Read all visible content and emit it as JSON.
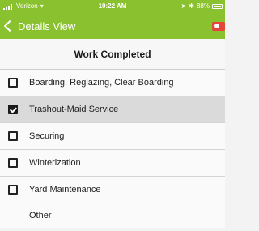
{
  "status_bar": {
    "carrier": "Verizon",
    "time": "10:22 AM",
    "battery": "88%"
  },
  "nav": {
    "back_label": "Details View"
  },
  "section": {
    "title": "Work Completed"
  },
  "items": [
    {
      "label": "Boarding, Reglazing, Clear Boarding",
      "checked": false
    },
    {
      "label": "Trashout-Maid Service",
      "checked": true
    },
    {
      "label": "Securing",
      "checked": false
    },
    {
      "label": "Winterization",
      "checked": false
    },
    {
      "label": "Yard Maintenance",
      "checked": false
    },
    {
      "label": "Other",
      "checked": false
    }
  ],
  "colors": {
    "header": "#8ac12f",
    "camera_icon": "#e5453a",
    "selected_row": "#dadada"
  }
}
